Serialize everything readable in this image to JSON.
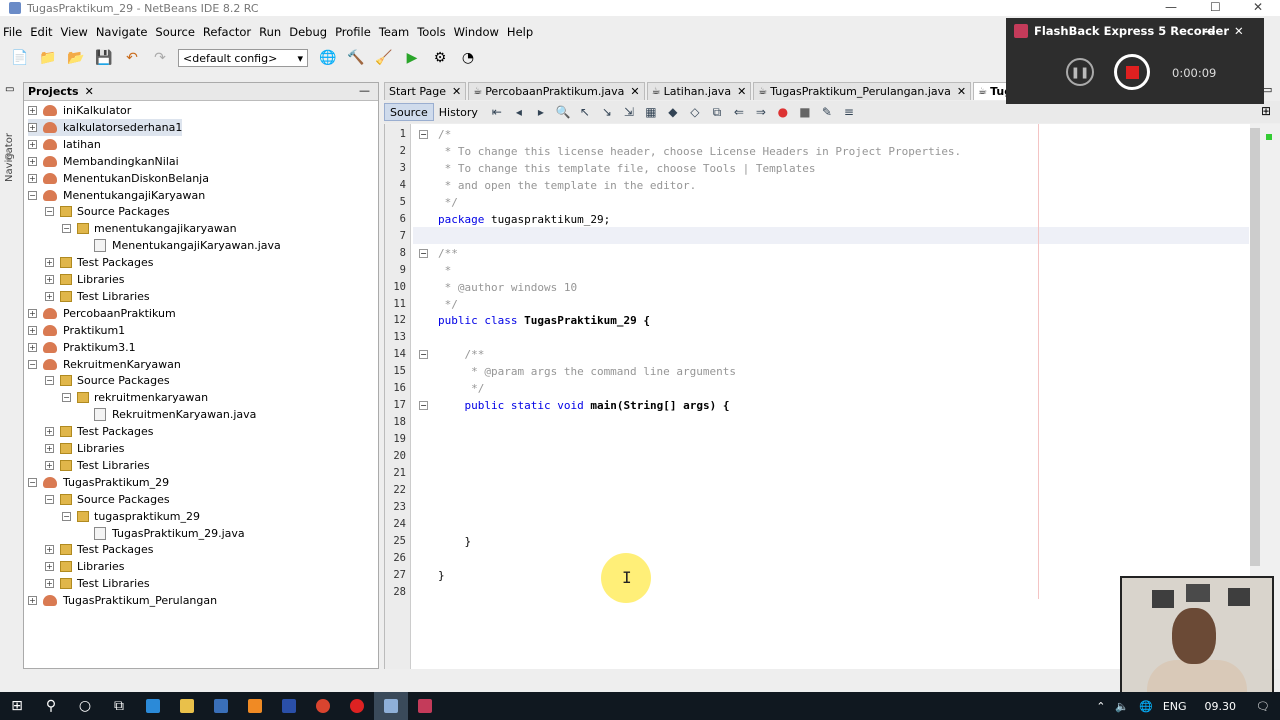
{
  "window": {
    "title": "TugasPraktikum_29 - NetBeans IDE 8.2 RC"
  },
  "menu": [
    "File",
    "Edit",
    "View",
    "Navigate",
    "Source",
    "Refactor",
    "Run",
    "Debug",
    "Profile",
    "Team",
    "Tools",
    "Window",
    "Help"
  ],
  "toolbar": {
    "config": "<default config>"
  },
  "navigator": {
    "label": "Navigator"
  },
  "projects": {
    "title": "Projects",
    "rows": [
      {
        "label": "iniKalkulator",
        "indent": 0,
        "type": "project",
        "toggle": "+"
      },
      {
        "label": "kalkulatorsederhana1",
        "indent": 0,
        "type": "project",
        "toggle": "+",
        "selected": true
      },
      {
        "label": "latihan",
        "indent": 0,
        "type": "project",
        "toggle": "+"
      },
      {
        "label": "MembandingkanNilai",
        "indent": 0,
        "type": "project",
        "toggle": "+"
      },
      {
        "label": "MenentukanDiskonBelanja",
        "indent": 0,
        "type": "project",
        "toggle": "+"
      },
      {
        "label": "MenentukangajiKaryawan",
        "indent": 0,
        "type": "project",
        "toggle": "-"
      },
      {
        "label": "Source Packages",
        "indent": 1,
        "type": "pkg",
        "toggle": "-"
      },
      {
        "label": "menentukangajikaryawan",
        "indent": 2,
        "type": "pkg",
        "toggle": "-"
      },
      {
        "label": "MenentukangajiKaryawan.java",
        "indent": 3,
        "type": "file",
        "toggle": ""
      },
      {
        "label": "Test Packages",
        "indent": 1,
        "type": "pkg",
        "toggle": "+"
      },
      {
        "label": "Libraries",
        "indent": 1,
        "type": "pkg",
        "toggle": "+"
      },
      {
        "label": "Test Libraries",
        "indent": 1,
        "type": "pkg",
        "toggle": "+"
      },
      {
        "label": "PercobaanPraktikum",
        "indent": 0,
        "type": "project",
        "toggle": "+"
      },
      {
        "label": "Praktikum1",
        "indent": 0,
        "type": "project",
        "toggle": "+"
      },
      {
        "label": "Praktikum3.1",
        "indent": 0,
        "type": "project",
        "toggle": "+"
      },
      {
        "label": "RekruitmenKaryawan",
        "indent": 0,
        "type": "project",
        "toggle": "-"
      },
      {
        "label": "Source Packages",
        "indent": 1,
        "type": "pkg",
        "toggle": "-"
      },
      {
        "label": "rekruitmenkaryawan",
        "indent": 2,
        "type": "pkg",
        "toggle": "-"
      },
      {
        "label": "RekruitmenKaryawan.java",
        "indent": 3,
        "type": "file",
        "toggle": ""
      },
      {
        "label": "Test Packages",
        "indent": 1,
        "type": "pkg",
        "toggle": "+"
      },
      {
        "label": "Libraries",
        "indent": 1,
        "type": "pkg",
        "toggle": "+"
      },
      {
        "label": "Test Libraries",
        "indent": 1,
        "type": "pkg",
        "toggle": "+"
      },
      {
        "label": "TugasPraktikum_29",
        "indent": 0,
        "type": "project",
        "toggle": "-"
      },
      {
        "label": "Source Packages",
        "indent": 1,
        "type": "pkg",
        "toggle": "-"
      },
      {
        "label": "tugaspraktikum_29",
        "indent": 2,
        "type": "pkg",
        "toggle": "-"
      },
      {
        "label": "TugasPraktikum_29.java",
        "indent": 3,
        "type": "file",
        "toggle": ""
      },
      {
        "label": "Test Packages",
        "indent": 1,
        "type": "pkg",
        "toggle": "+"
      },
      {
        "label": "Libraries",
        "indent": 1,
        "type": "pkg",
        "toggle": "+"
      },
      {
        "label": "Test Libraries",
        "indent": 1,
        "type": "pkg",
        "toggle": "+"
      },
      {
        "label": "TugasPraktikum_Perulangan",
        "indent": 0,
        "type": "project",
        "toggle": "+"
      }
    ]
  },
  "editor": {
    "tabs": [
      {
        "label": "Start Page",
        "active": false
      },
      {
        "label": "PercobaanPraktikum.java",
        "active": false
      },
      {
        "label": "Latihan.java",
        "active": false
      },
      {
        "label": "TugasPraktikum_Perulangan.java",
        "active": false
      },
      {
        "label": "TugasPrakti",
        "active": true
      }
    ],
    "source_label": "Source",
    "history_label": "History",
    "lines": [
      {
        "n": "1",
        "text": "/*",
        "cls": "cm",
        "fold": true
      },
      {
        "n": "2",
        "text": " * To change this license header, choose License Headers in Project Properties.",
        "cls": "cm"
      },
      {
        "n": "3",
        "text": " * To change this template file, choose Tools | Templates",
        "cls": "cm"
      },
      {
        "n": "4",
        "text": " * and open the template in the editor.",
        "cls": "cm"
      },
      {
        "n": "5",
        "text": " */",
        "cls": "cm"
      },
      {
        "n": "6",
        "text": "package tugaspraktikum_29;",
        "cls": "pkg"
      },
      {
        "n": "7",
        "text": "",
        "cls": ""
      },
      {
        "n": "8",
        "text": "/**",
        "cls": "cm",
        "fold": true
      },
      {
        "n": "9",
        "text": " *",
        "cls": "cm"
      },
      {
        "n": "10",
        "text": " * @author windows 10",
        "cls": "cm"
      },
      {
        "n": "11",
        "text": " */",
        "cls": "cm"
      },
      {
        "n": "12",
        "text": "public class TugasPraktikum_29 {",
        "cls": "cls"
      },
      {
        "n": "13",
        "text": "",
        "cls": ""
      },
      {
        "n": "14",
        "text": "    /**",
        "cls": "cm",
        "fold": true
      },
      {
        "n": "15",
        "text": "     * @param args the command line arguments",
        "cls": "cm"
      },
      {
        "n": "16",
        "text": "     */",
        "cls": "cm"
      },
      {
        "n": "17",
        "text": "    public static void main(String[] args) {",
        "cls": "main",
        "fold": true
      },
      {
        "n": "18",
        "text": "",
        "cls": ""
      },
      {
        "n": "19",
        "text": "",
        "cls": ""
      },
      {
        "n": "20",
        "text": "",
        "cls": ""
      },
      {
        "n": "21",
        "text": "",
        "cls": ""
      },
      {
        "n": "22",
        "text": "",
        "cls": ""
      },
      {
        "n": "23",
        "text": "",
        "cls": ""
      },
      {
        "n": "24",
        "text": "",
        "cls": ""
      },
      {
        "n": "25",
        "text": "    }",
        "cls": ""
      },
      {
        "n": "26",
        "text": "",
        "cls": ""
      },
      {
        "n": "27",
        "text": "}",
        "cls": ""
      },
      {
        "n": "28",
        "text": "",
        "cls": ""
      }
    ]
  },
  "recorder": {
    "title": "FlashBack Express 5 Recorder",
    "time": "0:00:09"
  },
  "taskbar": {
    "lang": "ENG",
    "clock": "09.30"
  }
}
